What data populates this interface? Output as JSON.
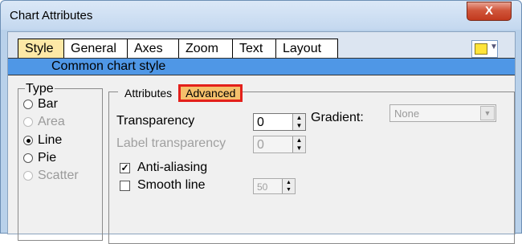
{
  "window": {
    "title": "Chart Attributes",
    "close_label": "X"
  },
  "tabs": [
    "Style",
    "General",
    "Axes",
    "Zoom",
    "Text",
    "Layout"
  ],
  "active_tab": "Style",
  "subtitle": "Common chart style",
  "type_group": {
    "label": "Type",
    "options": [
      {
        "label": "Bar",
        "selected": false,
        "enabled": true
      },
      {
        "label": "Area",
        "selected": false,
        "enabled": false
      },
      {
        "label": "Line",
        "selected": true,
        "enabled": true
      },
      {
        "label": "Pie",
        "selected": false,
        "enabled": true
      },
      {
        "label": "Scatter",
        "selected": false,
        "enabled": false
      }
    ]
  },
  "subtabs": [
    "Attributes",
    "Advanced"
  ],
  "active_subtab": "Advanced",
  "attributes": {
    "transparency_label": "Transparency",
    "transparency_value": "0",
    "label_transparency_label": "Label transparency",
    "label_transparency_value": "0",
    "gradient_label": "Gradient:",
    "gradient_value": "None",
    "anti_aliasing_label": "Anti-aliasing",
    "anti_aliasing_checked": true,
    "smooth_line_label": "Smooth line",
    "smooth_line_checked": false,
    "smooth_value": "50"
  },
  "colors": {
    "title_gradient": "#c4d8ef",
    "subtitle_bar": "#4f97e6",
    "active_tab": "#fde8a6",
    "highlight_border": "#e3201b"
  }
}
